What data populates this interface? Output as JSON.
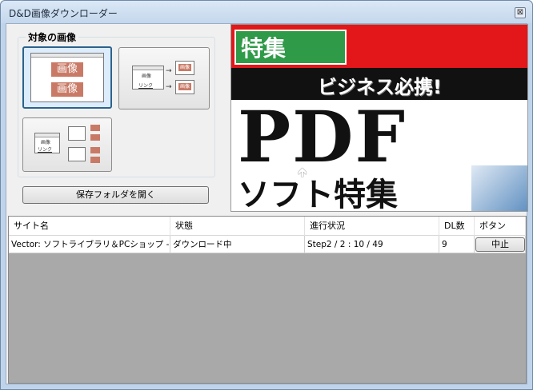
{
  "window": {
    "title": "D&D画像ダウンローダー",
    "close_glyph": "⊠"
  },
  "target": {
    "group_label": "対象の画像",
    "badge_image": "画像",
    "badge_link": "リンク"
  },
  "open_folder_label": "保存フォルダを開く",
  "preview": {
    "tag": "特集",
    "headline": "ビジネス必携!",
    "big": "PDF",
    "sub": "ソフト特集"
  },
  "table": {
    "columns": [
      "サイト名",
      "状態",
      "進行状況",
      "DL数",
      "ボタン"
    ],
    "rows": [
      {
        "site": "Vector: ソフトライブラリ＆PCショップ - ...",
        "status": "ダウンロード中",
        "progress": "Step2 /  2  :  10 / 49",
        "dl_count": "9",
        "button": "中止"
      }
    ]
  }
}
